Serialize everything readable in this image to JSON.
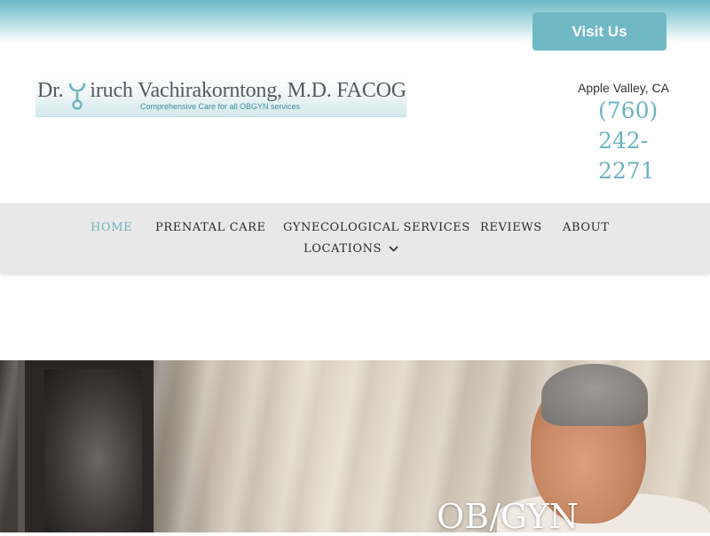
{
  "header": {
    "visit_button_label": "Visit Us",
    "logo": {
      "name_prefix": "Dr.",
      "name_rest": "iruch Vachirakorntong, M.D. FACOG",
      "tagline": "Comprehensive Care for all OBGYN services"
    },
    "location": "Apple Valley, CA",
    "phone_lines": [
      "(760)",
      "242-",
      "2271"
    ]
  },
  "nav": {
    "items": [
      {
        "label": "HOME",
        "active": true
      },
      {
        "label": "PRENATAL CARE",
        "active": false
      },
      {
        "label": "GYNECOLOGICAL SERVICES",
        "active": false
      },
      {
        "label": "REVIEWS",
        "active": false
      },
      {
        "label": "ABOUT",
        "active": false
      },
      {
        "label": "LOCATIONS",
        "active": false,
        "has_dropdown": true
      }
    ]
  },
  "hero": {
    "heading": "OB/GYN"
  },
  "colors": {
    "accent": "#6cb4bf",
    "button": "#70b9c4",
    "nav_background": "#e8e8e8",
    "nav_text": "#2a2a2a"
  },
  "icons": {
    "logo_mark": "stethoscope-icon",
    "dropdown": "chevron-down-icon"
  }
}
